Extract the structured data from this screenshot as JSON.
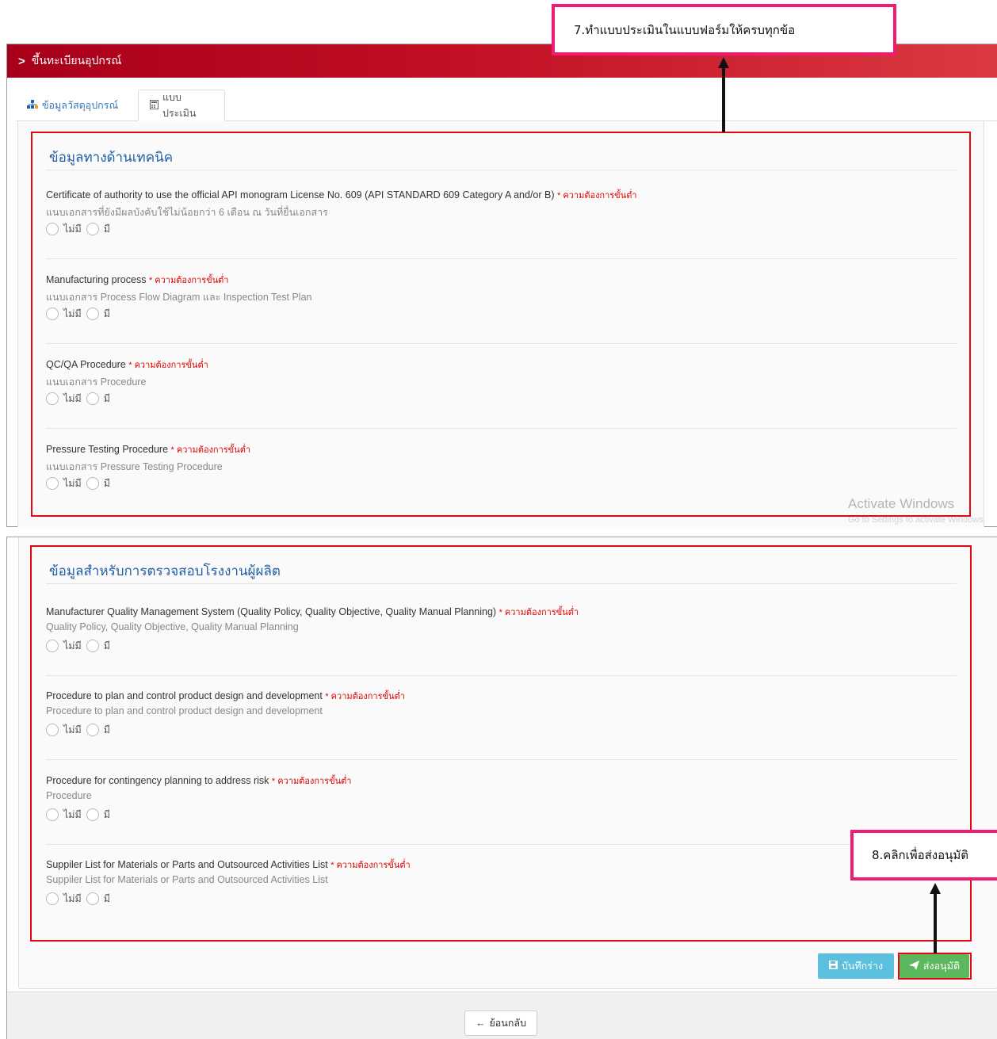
{
  "header": {
    "title": "ขึ้นทะเบียนอุปกรณ์"
  },
  "tabs": [
    {
      "label": "ข้อมูลวัสดุอุปกรณ์",
      "icon": "sitemap-icon"
    },
    {
      "label": "แบบประเมิน",
      "icon": "calculator-icon"
    }
  ],
  "required_label": "* ความต้องการขั้นต่ำ",
  "radio_options": {
    "no": "ไม่มี",
    "yes": "มี"
  },
  "sections": [
    {
      "title": "ข้อมูลทางด้านเทคนิค",
      "questions": [
        {
          "title": "Certificate of authority to use the official API monogram License No. 609 (API STANDARD 609 Category A and/or B)",
          "desc": "แนบเอกสารที่ยังมีผลบังคับใช้ไม่น้อยกว่า 6 เดือน ณ วันที่ยื่นเอกสาร"
        },
        {
          "title": "Manufacturing process",
          "desc": "แนบเอกสาร Process Flow Diagram และ Inspection Test Plan"
        },
        {
          "title": "QC/QA Procedure",
          "desc": "แนบเอกสาร Procedure"
        },
        {
          "title": "Pressure Testing Procedure",
          "desc": "แนบเอกสาร Pressure Testing Procedure"
        }
      ]
    },
    {
      "title": "ข้อมูลสำหรับการตรวจสอบโรงงานผู้ผลิต",
      "questions": [
        {
          "title": "Manufacturer Quality Management System (Quality Policy, Quality Objective, Quality Manual Planning)",
          "desc": "Quality Policy, Quality Objective, Quality Manual Planning"
        },
        {
          "title": "Procedure to plan and control product design and development",
          "desc": "Procedure to plan and control product design and development"
        },
        {
          "title": "Procedure for contingency planning to address risk",
          "desc": "Procedure"
        },
        {
          "title": "Suppiler List for Materials or Parts and Outsourced Activities List",
          "desc": "Suppiler List for Materials or Parts and Outsourced Activities List"
        }
      ]
    }
  ],
  "buttons": {
    "draft": "บันทึกร่าง",
    "submit": "ส่งอนุมัติ",
    "back": "ย้อนกลับ"
  },
  "callouts": {
    "step7": "7.ทำแบบประเมินในแบบฟอร์มให้ครบทุกข้อ",
    "step8": "8.คลิกเพื่อส่งอนุมัติ"
  },
  "watermark": {
    "line1": "Activate Windows",
    "line2": "Go to Settings to activate Windows."
  },
  "colors": {
    "header_red": "#c20f24",
    "highlight_red": "#e30613",
    "callout_pink": "#ee1d73",
    "title_blue": "#1f5fa6",
    "draft_blue": "#5bc0de",
    "submit_green": "#5cb85c"
  }
}
